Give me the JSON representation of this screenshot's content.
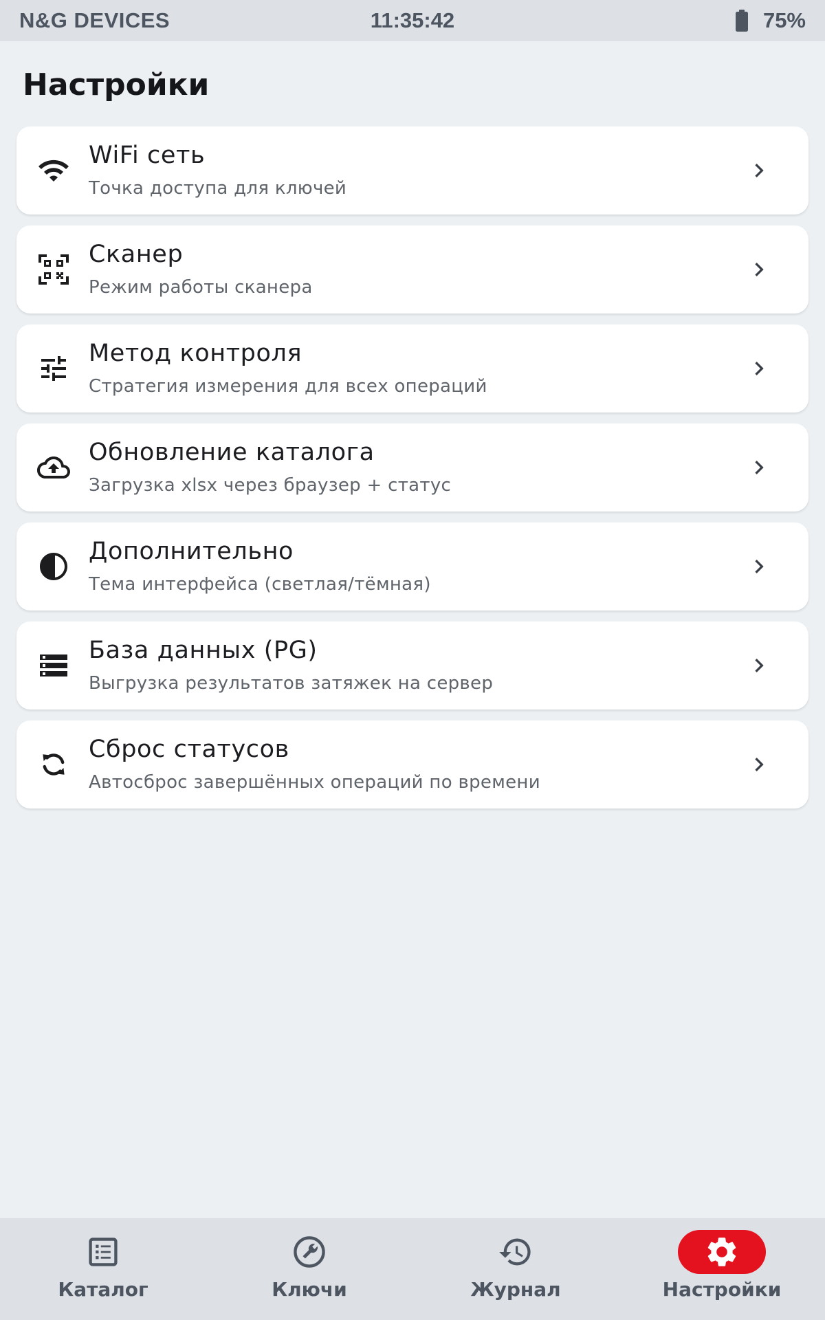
{
  "status_bar": {
    "brand": "N&G DEVICES",
    "time": "11:35:42",
    "battery": "75%",
    "battery_icon": "battery-icon"
  },
  "page": {
    "title": "Настройки"
  },
  "settings": [
    {
      "icon": "wifi-icon",
      "title": "WiFi сеть",
      "subtitle": "Точка доступа для ключей"
    },
    {
      "icon": "qr-scanner-icon",
      "title": "Сканер",
      "subtitle": "Режим работы сканера"
    },
    {
      "icon": "tune-icon",
      "title": "Метод контроля",
      "subtitle": "Стратегия измерения для всех операций"
    },
    {
      "icon": "cloud-upload-icon",
      "title": "Обновление каталога",
      "subtitle": "Загрузка xlsx через браузер + статус"
    },
    {
      "icon": "contrast-icon",
      "title": "Дополнительно",
      "subtitle": "Тема интерфейса (светлая/тёмная)"
    },
    {
      "icon": "database-icon",
      "title": "База данных (PG)",
      "subtitle": "Выгрузка результатов затяжек на сервер"
    },
    {
      "icon": "refresh-icon",
      "title": "Сброс статусов",
      "subtitle": "Автосброс завершённых операций по времени"
    }
  ],
  "bottom_nav": {
    "items": [
      {
        "icon": "catalog-icon",
        "label": "Каталог",
        "active": false
      },
      {
        "icon": "wrench-icon",
        "label": "Ключи",
        "active": false
      },
      {
        "icon": "history-icon",
        "label": "Журнал",
        "active": false
      },
      {
        "icon": "settings-icon",
        "label": "Настройки",
        "active": true
      }
    ]
  },
  "colors": {
    "accent": "#e4121f",
    "background": "#edf0f3",
    "bar": "#dde1e6"
  }
}
